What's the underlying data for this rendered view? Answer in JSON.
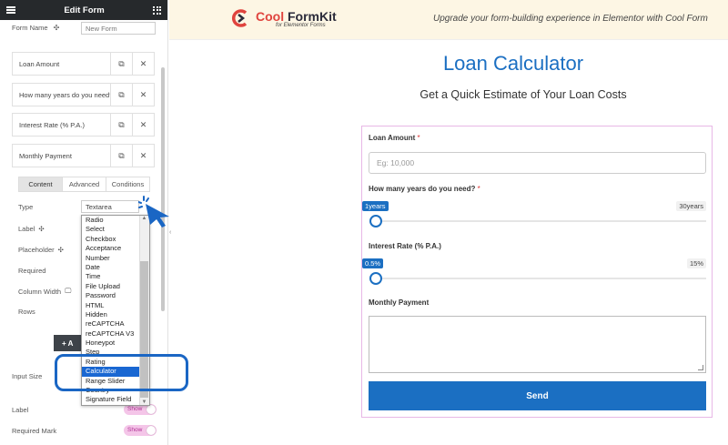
{
  "editor": {
    "title": "Edit Form",
    "form_name_label": "Form Name",
    "form_name_value": "New Form",
    "fields": [
      {
        "label": "Loan Amount"
      },
      {
        "label": "How many years do you need?"
      },
      {
        "label": "Interest Rate (% P.A.)"
      },
      {
        "label": "Monthly Payment"
      }
    ],
    "tabs": [
      {
        "label": "Content",
        "active": true
      },
      {
        "label": "Advanced",
        "active": false
      },
      {
        "label": "Conditions",
        "active": false
      }
    ],
    "controls": {
      "type": "Type",
      "label": "Label",
      "placeholder": "Placeholder",
      "required": "Required",
      "column_width": "Column Width",
      "rows": "Rows"
    },
    "type_value": "Textarea",
    "type_options": [
      "Radio",
      "Select",
      "Checkbox",
      "Acceptance",
      "Number",
      "Date",
      "Time",
      "File Upload",
      "Password",
      "HTML",
      "Hidden",
      "reCAPTCHA",
      "reCAPTCHA V3",
      "Honeypot",
      "Step",
      "Rating",
      "Calculator",
      "Range Slider",
      "Country",
      "Signature Field"
    ],
    "selected_option": "Calculator",
    "add_item_label": "+ A",
    "input_size_label": "Input Size",
    "label_toggle_label": "Label",
    "label_toggle_value": "Show",
    "required_mark_label": "Required Mark",
    "required_mark_value": "Show"
  },
  "banner": {
    "brand_part1": "Cool",
    "brand_part2": " FormKit",
    "brand_sub": "for Elementor Forms",
    "tagline": "Upgrade your form-building experience in Elementor with Cool Form"
  },
  "preview": {
    "title": "Loan Calculator",
    "subtitle": "Get a Quick Estimate of Your Loan Costs",
    "loan_amount_label": "Loan Amount",
    "loan_amount_placeholder": "Eg: 10,000",
    "years_label": "How many years do you need?",
    "years_min": "1years",
    "years_max": "30years",
    "interest_label": "Interest Rate (% P.A.)",
    "interest_min": "0.5%",
    "interest_max": "15%",
    "monthly_label": "Monthly Payment",
    "required_mark": "*",
    "send_label": "Send"
  },
  "colors": {
    "primary": "#1b6fc2",
    "brand_red": "#e0443e",
    "form_border": "#e8b7e6",
    "banner_bg": "#fdf6e4"
  }
}
